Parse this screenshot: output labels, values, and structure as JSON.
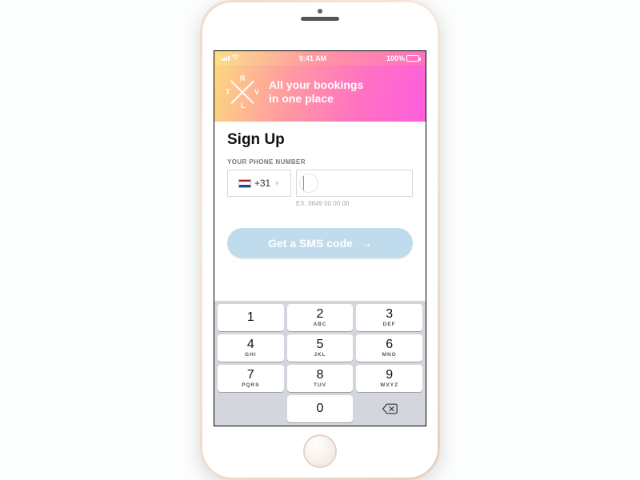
{
  "statusbar": {
    "time": "9:41 AM",
    "battery_text": "100%"
  },
  "hero": {
    "logo_letters": {
      "t": "T",
      "r": "R",
      "v": "V",
      "l": "L"
    },
    "line1": "All your bookings",
    "line2": "in one place"
  },
  "signup": {
    "title": "Sign Up",
    "field_label": "YOUR PHONE NUMBER",
    "country_code": "+31",
    "phone_value": "",
    "example": "EX. 0649 00 00 00"
  },
  "cta": {
    "label": "Get a SMS code"
  },
  "keypad": {
    "keys": [
      {
        "digit": "1",
        "letters": ""
      },
      {
        "digit": "2",
        "letters": "ABC"
      },
      {
        "digit": "3",
        "letters": "DEF"
      },
      {
        "digit": "4",
        "letters": "GHI"
      },
      {
        "digit": "5",
        "letters": "JKL"
      },
      {
        "digit": "6",
        "letters": "MNO"
      },
      {
        "digit": "7",
        "letters": "PQRS"
      },
      {
        "digit": "8",
        "letters": "TUV"
      },
      {
        "digit": "9",
        "letters": "WXYZ"
      },
      {
        "digit": "0",
        "letters": ""
      }
    ]
  },
  "colors": {
    "hero_gradient_start": "#fcd77f",
    "hero_gradient_end": "#ff5edc",
    "cta_bg": "#c0dbeb",
    "accent": "#3da7d6"
  }
}
